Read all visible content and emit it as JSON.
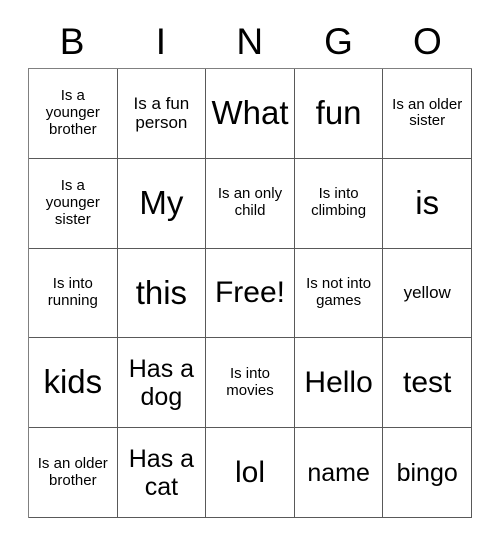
{
  "card": {
    "title": "BINGO",
    "header_letters": [
      "B",
      "I",
      "N",
      "G",
      "O"
    ],
    "free_space_label": "Free!",
    "colors": {
      "background": "#ffffff",
      "text": "#000000",
      "grid_line": "#595959",
      "grid_outer": "#808080"
    },
    "grid": {
      "columns": 5,
      "rows": 5,
      "cells": [
        [
          {
            "text": "Is a younger brother",
            "size": "xs"
          },
          {
            "text": "Is a fun person",
            "size": "s"
          },
          {
            "text": "What",
            "size": "xl"
          },
          {
            "text": "fun",
            "size": "xl"
          },
          {
            "text": "Is an older sister",
            "size": "xs"
          }
        ],
        [
          {
            "text": "Is a younger sister",
            "size": "xs"
          },
          {
            "text": "My",
            "size": "xl"
          },
          {
            "text": "Is an only child",
            "size": "xs"
          },
          {
            "text": "Is into climbing",
            "size": "xs"
          },
          {
            "text": "is",
            "size": "xl"
          }
        ],
        [
          {
            "text": "Is into running",
            "size": "xs"
          },
          {
            "text": "this",
            "size": "xl"
          },
          {
            "text": "Free!",
            "size": "l"
          },
          {
            "text": "Is not into games",
            "size": "xs"
          },
          {
            "text": "yellow",
            "size": "s"
          }
        ],
        [
          {
            "text": "kids",
            "size": "xl"
          },
          {
            "text": "Has a dog",
            "size": "m"
          },
          {
            "text": "Is into movies",
            "size": "xs"
          },
          {
            "text": "Hello",
            "size": "l"
          },
          {
            "text": "test",
            "size": "l"
          }
        ],
        [
          {
            "text": "Is an older brother",
            "size": "xs"
          },
          {
            "text": "Has a cat",
            "size": "m"
          },
          {
            "text": "lol",
            "size": "l"
          },
          {
            "text": "name",
            "size": "m"
          },
          {
            "text": "bingo",
            "size": "m"
          }
        ]
      ]
    }
  }
}
